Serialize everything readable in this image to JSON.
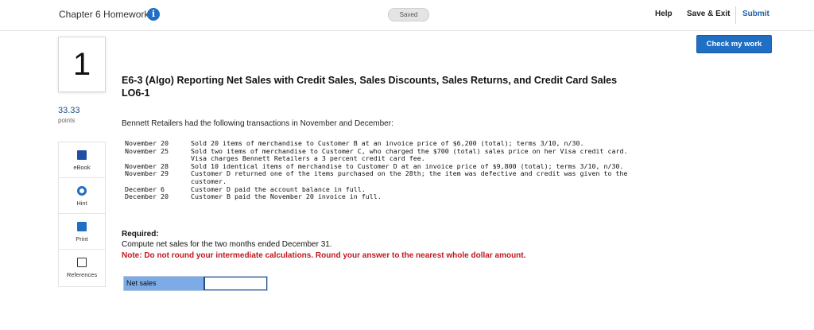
{
  "header": {
    "chapter_title": "Chapter 6 Homework",
    "info_glyph": "i",
    "saved_status": "Saved",
    "help_label": "Help",
    "save_exit_label": "Save & Exit",
    "submit_label": "Submit"
  },
  "check_button_label": "Check my work",
  "question": {
    "number": "1",
    "points_value": "33.33",
    "points_label": "points",
    "title_line1": "E6-3 (Algo) Reporting Net Sales with Credit Sales, Sales Discounts, Sales Returns, and Credit Card Sales",
    "title_line2": "LO6-1",
    "intro": "Bennett Retailers had the following transactions in November and December:",
    "transactions": [
      {
        "date": "November 20",
        "description": "Sold 20 items of merchandise to Customer B at an invoice price of $6,200 (total); terms 3/10, n/30."
      },
      {
        "date": "November 25",
        "description": "Sold two items of merchandise to Customer C, who charged the $700 (total) sales price on her Visa credit card. Visa charges Bennett Retailers a 3 percent credit card fee."
      },
      {
        "date": "November 28",
        "description": "Sold 10 identical items of merchandise to Customer D at an invoice price of $9,800 (total); terms 3/10, n/30."
      },
      {
        "date": "November 29",
        "description": "Customer D returned one of the items purchased on the 28th; the item was defective and credit was given to the customer."
      },
      {
        "date": "December 6",
        "description": "Customer D paid the account balance in full."
      },
      {
        "date": "December 20",
        "description": "Customer B paid the November 20 invoice in full."
      }
    ],
    "required_label": "Required:",
    "compute_text": "Compute net sales for the two months ended December 31.",
    "note_text": "Note: Do not round your intermediate calculations. Round your answer to the nearest whole dollar amount.",
    "answer_label": "Net sales",
    "answer_value": ""
  },
  "tools": {
    "ebook": {
      "label": "eBook",
      "icon": "book-icon"
    },
    "hint": {
      "label": "Hint",
      "icon": "lifebuoy-icon"
    },
    "print": {
      "label": "Print",
      "icon": "printer-icon"
    },
    "references": {
      "label": "References",
      "icon": "documents-icon"
    }
  },
  "colors": {
    "accent_blue": "#1f6fc5",
    "answer_label_bg": "#7cabe6",
    "note_red": "#c0181f"
  }
}
